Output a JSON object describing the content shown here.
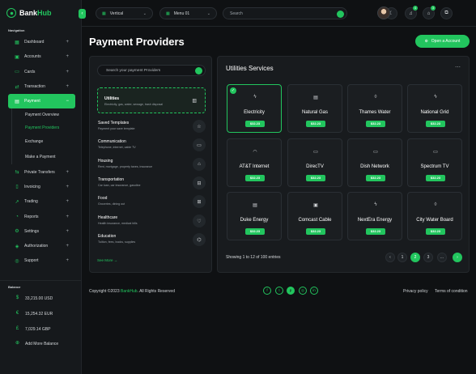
{
  "brand": {
    "name_a": "Bank",
    "name_b": "Hub"
  },
  "sidebar": {
    "navigation_heading": "Navigation",
    "items": [
      {
        "label": "Dashboard",
        "icon": "dashboard-icon"
      },
      {
        "label": "Accounts",
        "icon": "wallet-icon"
      },
      {
        "label": "Cards",
        "icon": "card-icon"
      },
      {
        "label": "Transaction",
        "icon": "transfer-icon"
      },
      {
        "label": "Payment",
        "icon": "payment-icon"
      }
    ],
    "payment_sub": [
      "Payment Overview",
      "Payment Providers",
      "Exchange",
      "Make a Payment"
    ],
    "items_after": [
      {
        "label": "Private Transfers",
        "icon": "transfer-icon"
      },
      {
        "label": "Invoicing",
        "icon": "invoice-icon"
      },
      {
        "label": "Trading",
        "icon": "chart-icon"
      },
      {
        "label": "Reports",
        "icon": "report-icon"
      },
      {
        "label": "Settings",
        "icon": "gear-icon"
      },
      {
        "label": "Authorization",
        "icon": "shield-icon"
      },
      {
        "label": "Support",
        "icon": "support-icon"
      }
    ],
    "balance_heading": "Balance",
    "balances": [
      {
        "label": "33,215.00 USD",
        "icon": "dollar-icon"
      },
      {
        "label": "15,254.32 EUR",
        "icon": "euro-icon"
      },
      {
        "label": "7,029.14 GBP",
        "icon": "pound-icon"
      }
    ],
    "add_balance": "Add More Balance"
  },
  "topbar": {
    "layout_select": "Vertical",
    "menu_select": "Menu 01",
    "search_placeholder": "Search",
    "notif_badge": "4",
    "cart_badge": "3"
  },
  "page": {
    "title": "Payment Providers",
    "open_account": "Open a Account"
  },
  "left": {
    "search_placeholder": "Search your payment Providers",
    "utilities": {
      "title": "Utilities",
      "desc": "Electricity, gas, water, sewage, trash disposal"
    },
    "categories": [
      {
        "title": "Saved Templates",
        "desc": "Payment your save template",
        "icon": "star-icon"
      },
      {
        "title": "Communication",
        "desc": "Telephone, internet, cable TV",
        "icon": "monitor-icon"
      },
      {
        "title": "Housing",
        "desc": "Rent, mortgage, property taxes, insurance",
        "icon": "home-icon"
      },
      {
        "title": "Transportation",
        "desc": "Car loan, car insurance, gasoline",
        "icon": "car-icon"
      },
      {
        "title": "Food",
        "desc": "Groceries, dining out",
        "icon": "basket-icon"
      },
      {
        "title": "Healthcare",
        "desc": "Health insurance, medical bills",
        "icon": "heart-icon"
      },
      {
        "title": "Education",
        "desc": "Tuition, fees, books, supplies",
        "icon": "graduation-icon"
      }
    ],
    "see_more": "See More →"
  },
  "right": {
    "title": "Utilities Services",
    "providers": [
      {
        "name": "Electricity",
        "price": "$32.23",
        "icon": "bolt-icon"
      },
      {
        "name": "Natural Gas",
        "price": "$32.23",
        "icon": "gas-icon"
      },
      {
        "name": "Thames Water",
        "price": "$32.23",
        "icon": "drop-icon"
      },
      {
        "name": "National Grid",
        "price": "$32.23",
        "icon": "bolt-icon"
      },
      {
        "name": "AT&T Internet",
        "price": "$32.23",
        "icon": "wifi-icon"
      },
      {
        "name": "DirecTV",
        "price": "$32.23",
        "icon": "tv-icon"
      },
      {
        "name": "Dish Network",
        "price": "$32.23",
        "icon": "tv-icon"
      },
      {
        "name": "Spectrum TV",
        "price": "$32.23",
        "icon": "tv-icon"
      },
      {
        "name": "Duke Energy",
        "price": "$32.23",
        "icon": "gas-icon"
      },
      {
        "name": "Comcast Cable",
        "price": "$32.23",
        "icon": "cable-icon"
      },
      {
        "name": "NextEra Energy",
        "price": "$32.23",
        "icon": "bolt-icon"
      },
      {
        "name": "City Water Board",
        "price": "$32.23",
        "icon": "drop-icon"
      }
    ],
    "showing": "Showing 1 to 12 of 100 entries",
    "pages": [
      "1",
      "2",
      "3",
      "..."
    ]
  },
  "footer": {
    "copy_a": "Copyright ©2023 ",
    "copy_brand": "BankHub",
    "copy_b": ". All Rights Reserved",
    "privacy": "Privacy policy",
    "terms": "Terms of condition"
  },
  "colors": {
    "accent": "#22c55e",
    "bg": "#0f1113",
    "panel": "#181b1e"
  }
}
